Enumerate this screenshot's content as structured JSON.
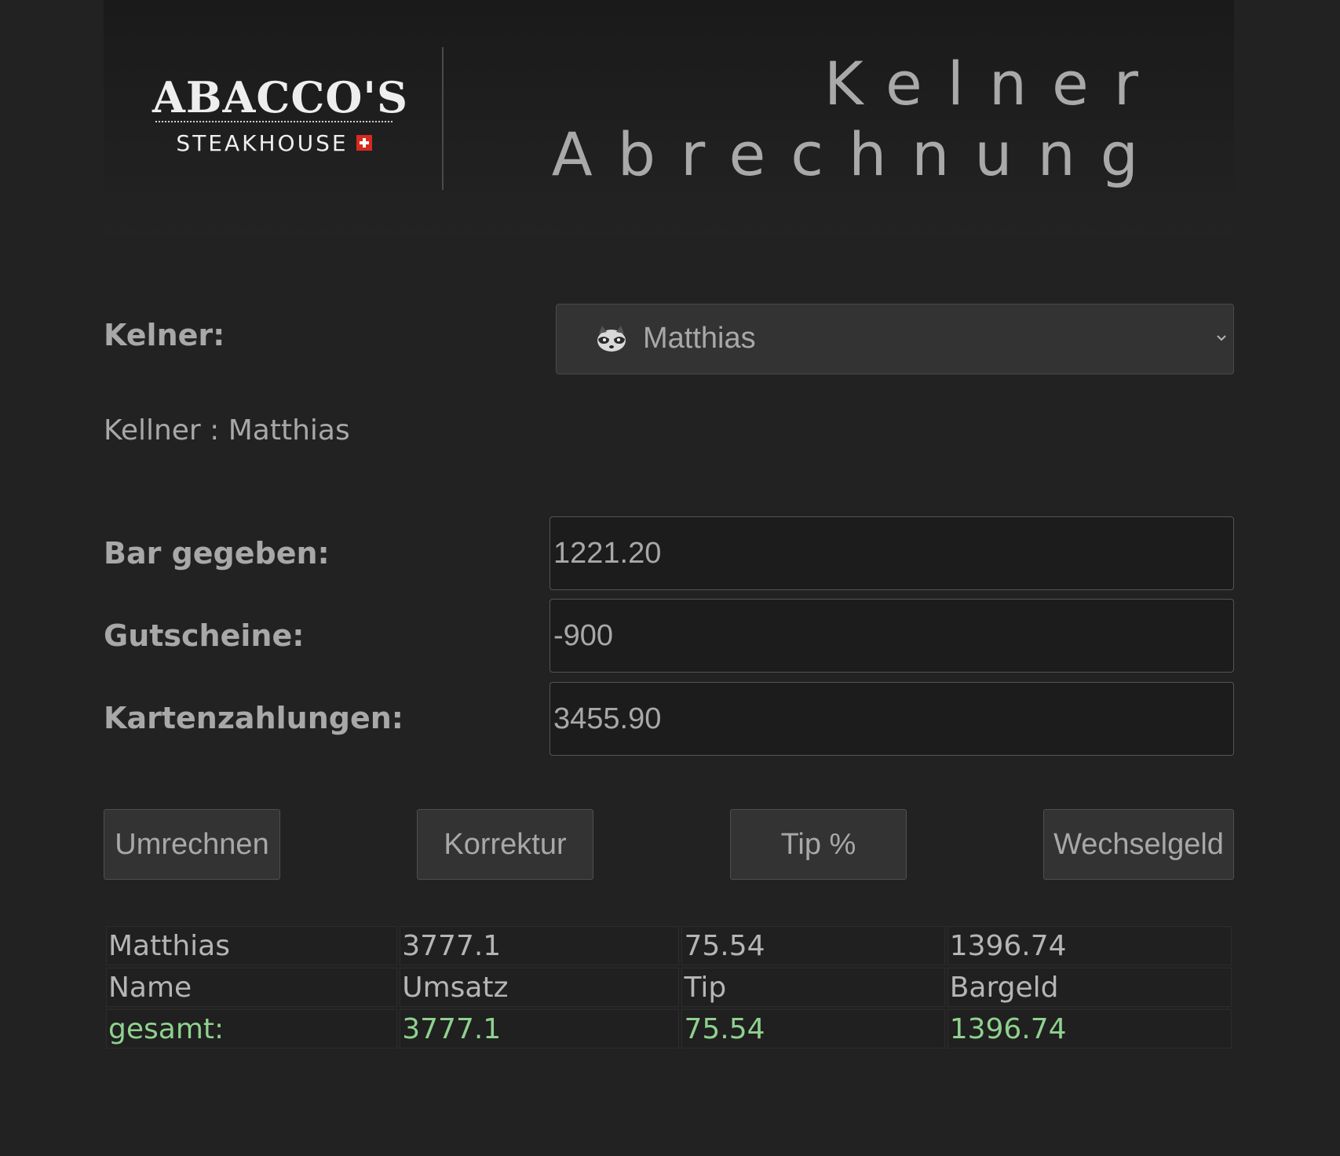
{
  "header": {
    "logo_main": "ABACCO'S",
    "logo_sub": "STEAKHOUSE",
    "title_line1": "Kelner",
    "title_line2": "Abrechnung"
  },
  "waiter_select": {
    "label": "Kelner:",
    "icon": "raccoon-icon",
    "selected": "Matthias"
  },
  "info": {
    "waiter_line": "Kellner : Matthias"
  },
  "fields": {
    "bar": {
      "label": "Bar gegeben:",
      "value": "1221.20"
    },
    "vouchers": {
      "label": "Gutscheine:",
      "value": "-900"
    },
    "cards": {
      "label": "Kartenzahlungen:",
      "value": "3455.90"
    }
  },
  "buttons": {
    "convert": "Umrechnen",
    "correct": "Korrektur",
    "tip": "Tip %",
    "change": "Wechselgeld"
  },
  "table": {
    "data_row": [
      "Matthias",
      "3777.1",
      "75.54",
      "1396.74"
    ],
    "header_row": [
      "Name",
      "Umsatz",
      "Tip",
      "Bargeld"
    ],
    "total_row": [
      "gesamt:",
      "3777.1",
      "75.54",
      "1396.74"
    ]
  },
  "colors": {
    "background": "#222222",
    "text": "#b5b5b5",
    "total_text": "#8fd18f",
    "flag_red": "#d52b1e"
  }
}
